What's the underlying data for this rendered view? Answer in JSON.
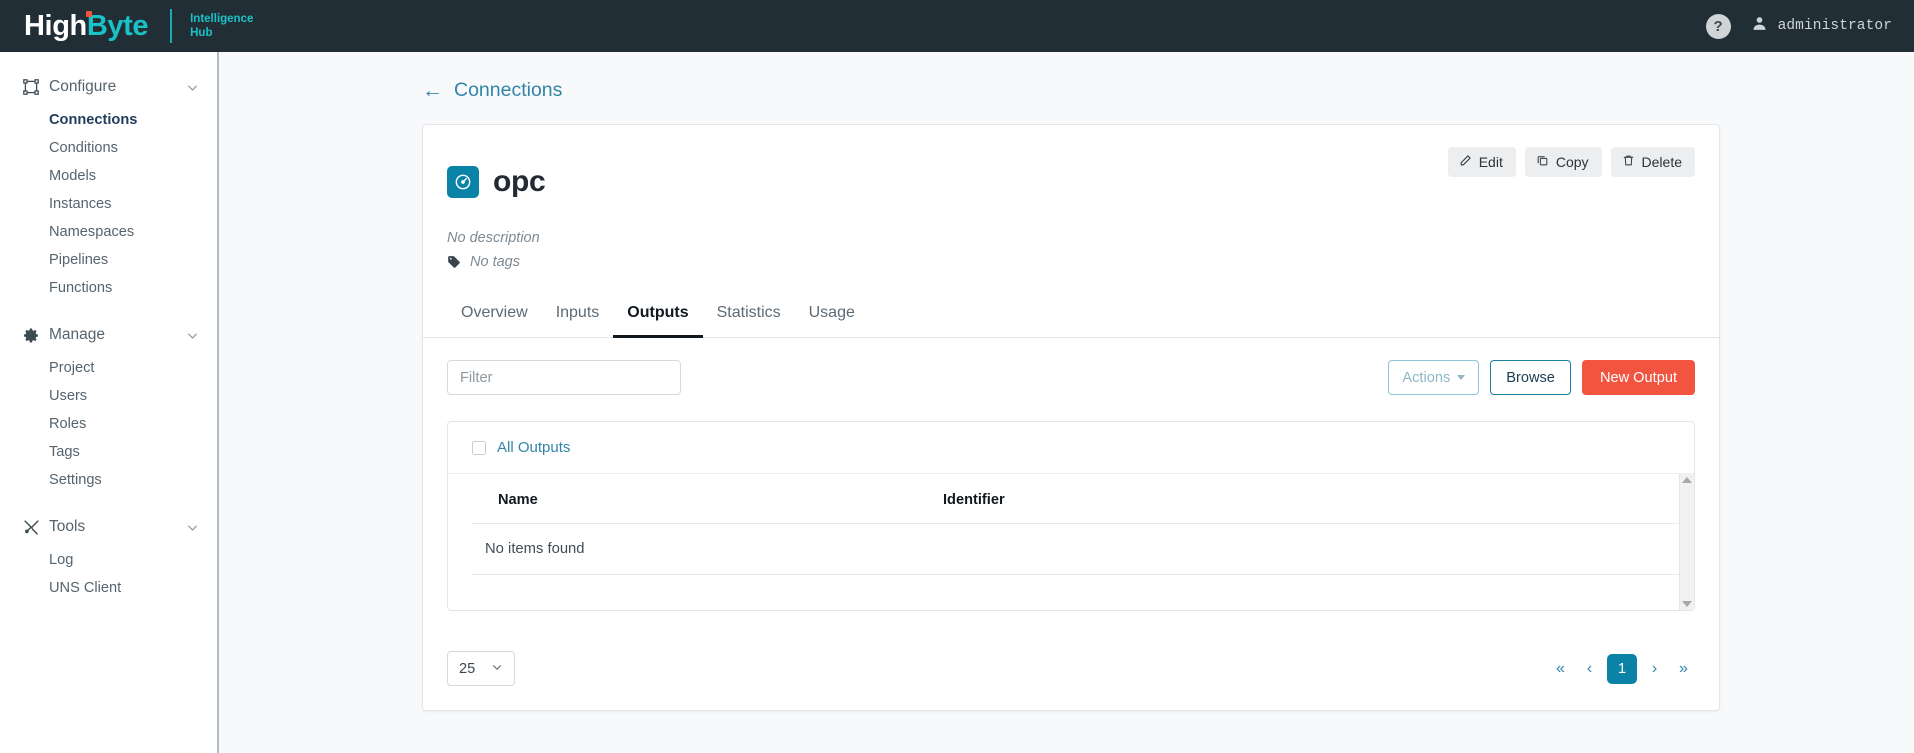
{
  "header": {
    "brand_high": "High",
    "brand_byte": "Byte",
    "product_line1": "Intelligence",
    "product_line2": "Hub",
    "help_label": "?",
    "help_icon": "question-circle-icon",
    "user_icon": "user-avatar-icon",
    "user_name": "administrator"
  },
  "sidebar": {
    "groups": [
      {
        "label": "Configure",
        "icon": "configure-icon",
        "chevron": "chevron-down-icon",
        "items": [
          {
            "label": "Connections",
            "active": true
          },
          {
            "label": "Conditions",
            "active": false
          },
          {
            "label": "Models",
            "active": false
          },
          {
            "label": "Instances",
            "active": false
          },
          {
            "label": "Namespaces",
            "active": false
          },
          {
            "label": "Pipelines",
            "active": false
          },
          {
            "label": "Functions",
            "active": false
          }
        ]
      },
      {
        "label": "Manage",
        "icon": "gear-icon",
        "chevron": "chevron-down-icon",
        "items": [
          {
            "label": "Project",
            "active": false
          },
          {
            "label": "Users",
            "active": false
          },
          {
            "label": "Roles",
            "active": false
          },
          {
            "label": "Tags",
            "active": false
          },
          {
            "label": "Settings",
            "active": false
          }
        ]
      },
      {
        "label": "Tools",
        "icon": "tools-icon",
        "chevron": "chevron-down-icon",
        "items": [
          {
            "label": "Log",
            "active": false
          },
          {
            "label": "UNS Client",
            "active": false
          }
        ]
      }
    ]
  },
  "breadcrumb": {
    "back_icon": "arrow-left-icon",
    "label": "Connections"
  },
  "detail": {
    "icon": "opc-connection-icon",
    "title": "opc",
    "description": "No description",
    "tags_icon": "tag-icon",
    "tags": "No tags",
    "actions": [
      {
        "label": "Edit",
        "icon": "pencil-icon"
      },
      {
        "label": "Copy",
        "icon": "copy-icon"
      },
      {
        "label": "Delete",
        "icon": "trash-icon"
      }
    ],
    "tabs": [
      {
        "label": "Overview",
        "active": false
      },
      {
        "label": "Inputs",
        "active": false
      },
      {
        "label": "Outputs",
        "active": true
      },
      {
        "label": "Statistics",
        "active": false
      },
      {
        "label": "Usage",
        "active": false
      }
    ]
  },
  "toolbar": {
    "filter_placeholder": "Filter",
    "filter_value": "",
    "actions_label": "Actions",
    "actions_caret": "caret-down-icon",
    "browse_label": "Browse",
    "new_output_label": "New Output"
  },
  "table": {
    "select_all_label": "All Outputs",
    "select_all_checked": false,
    "columns": [
      "Name",
      "Identifier"
    ],
    "rows": [],
    "empty_message": "No items found",
    "scrollbar_up_icon": "scroll-up-arrow-icon",
    "scrollbar_down_icon": "scroll-down-arrow-icon"
  },
  "pagination": {
    "page_size": "25",
    "page_size_chevron": "chevron-down-icon",
    "first_label": "«",
    "prev_label": "‹",
    "current_page": "1",
    "next_label": "›",
    "last_label": "»"
  },
  "colors": {
    "header_bg": "#222e35",
    "brand_teal": "#19c2c6",
    "brand_red": "#f1543f",
    "link_blue": "#3384a8",
    "accent_teal": "#0a83a6",
    "primary_btn": "#f1543f",
    "main_bg": "#f8f9fa"
  }
}
